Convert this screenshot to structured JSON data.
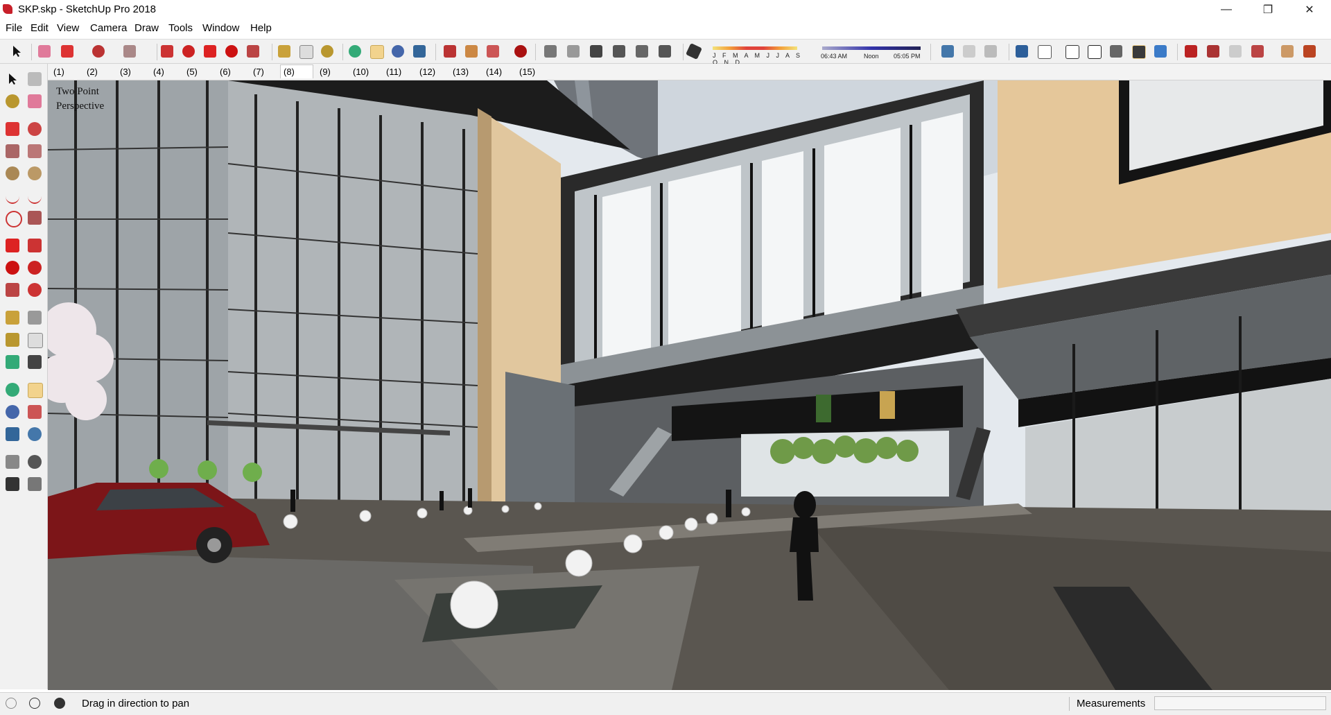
{
  "window": {
    "title": "SKP.skp - SketchUp Pro 2018",
    "minimize_glyph": "—",
    "maximize_glyph": "❐",
    "close_glyph": "✕"
  },
  "menu": {
    "items": [
      "File",
      "Edit",
      "View",
      "Camera",
      "Draw",
      "Tools",
      "Window",
      "Help"
    ]
  },
  "shadow_settings": {
    "months": "J F M A M J J A S O N D",
    "time_start": "06:43 AM",
    "time_mid": "Noon",
    "time_end": "05:05 PM"
  },
  "scenes": {
    "tabs": [
      "(1)",
      "(2)",
      "(3)",
      "(4)",
      "(5)",
      "(6)",
      "(7)",
      "(8)",
      "(9)",
      "(10)",
      "(11)",
      "(12)",
      "(13)",
      "(14)",
      "(15)"
    ],
    "active": "(8)"
  },
  "viewport": {
    "camera_label_line1": "Two Point",
    "camera_label_line2": "Perspective"
  },
  "status": {
    "hint": "Drag in direction to pan",
    "measurements_label": "Measurements",
    "measurements_value": ""
  },
  "colors": {
    "accent_red": "#c8202a",
    "active_tool": "#f2d38d",
    "brand_red": "#b5121b"
  },
  "icons": {
    "app": "sketchup-logo-icon",
    "select": "select-arrow-icon",
    "eraser": "eraser-icon",
    "pencil": "pencil-icon",
    "rectangle": "rectangle-icon",
    "push_pull": "push-pull-icon",
    "move": "move-icon",
    "rotate": "rotate-icon",
    "scale": "scale-icon",
    "tape": "tape-measure-icon",
    "text": "text-icon",
    "paint": "paint-bucket-icon",
    "orbit": "orbit-icon",
    "pan": "pan-icon",
    "zoom": "zoom-icon",
    "zoom_extents": "zoom-extents-icon"
  }
}
